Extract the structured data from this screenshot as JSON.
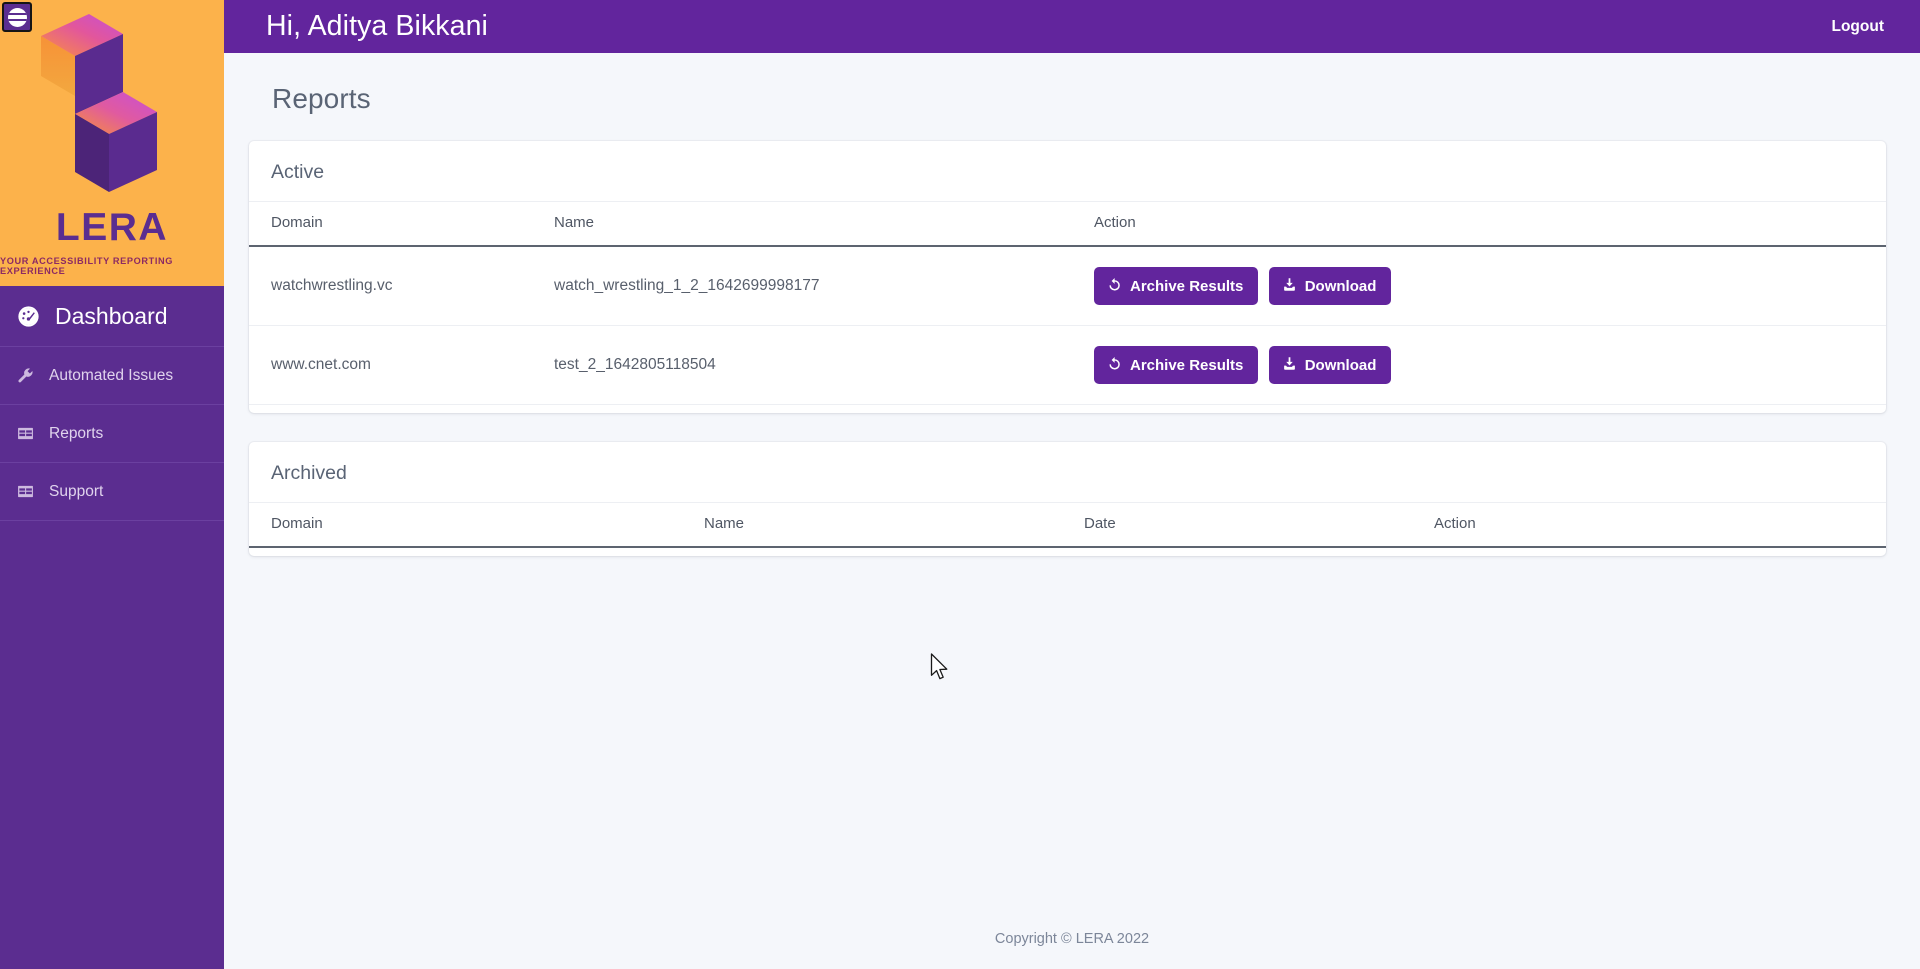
{
  "brand": {
    "name": "LERA",
    "tagline": "YOUR ACCESSIBILITY REPORTING EXPERIENCE",
    "logo_bg": "#FCB24B",
    "logo_purple": "#5B2D90",
    "logo_magenta": "#C147C9",
    "logo_orange": "#F78B3C",
    "tagline_color": "#8C2A63"
  },
  "colors": {
    "sidebar": "#5B2D90",
    "topbar": "#62259D",
    "accent": "#62259D",
    "page_bg": "#F5F7FB",
    "card_bg": "#FFFFFF",
    "text_muted": "#5A6475"
  },
  "sidebar": {
    "menu_toggle_name": "hamburger-menu-icon",
    "items": [
      {
        "label": "Dashboard",
        "icon": "gauge-icon",
        "active": true
      },
      {
        "label": "Automated Issues",
        "icon": "wrench-icon",
        "active": false
      },
      {
        "label": "Reports",
        "icon": "table-grid-icon",
        "active": false
      },
      {
        "label": "Support",
        "icon": "table-grid-icon",
        "active": false
      }
    ]
  },
  "topbar": {
    "greeting": "Hi, Aditya Bikkani",
    "logout_label": "Logout"
  },
  "page": {
    "title": "Reports"
  },
  "active_section": {
    "title": "Active",
    "columns": [
      "Domain",
      "Name",
      "Action"
    ],
    "rows": [
      {
        "domain": "watchwrestling.vc",
        "name": "watch_wrestling_1_2_1642699998177",
        "archive_label": "Archive Results",
        "download_label": "Download"
      },
      {
        "domain": "www.cnet.com",
        "name": "test_2_1642805118504",
        "archive_label": "Archive Results",
        "download_label": "Download"
      }
    ]
  },
  "archived_section": {
    "title": "Archived",
    "columns": [
      "Domain",
      "Name",
      "Date",
      "Action"
    ],
    "rows": []
  },
  "footer": {
    "copyright": "Copyright © LERA 2022"
  }
}
